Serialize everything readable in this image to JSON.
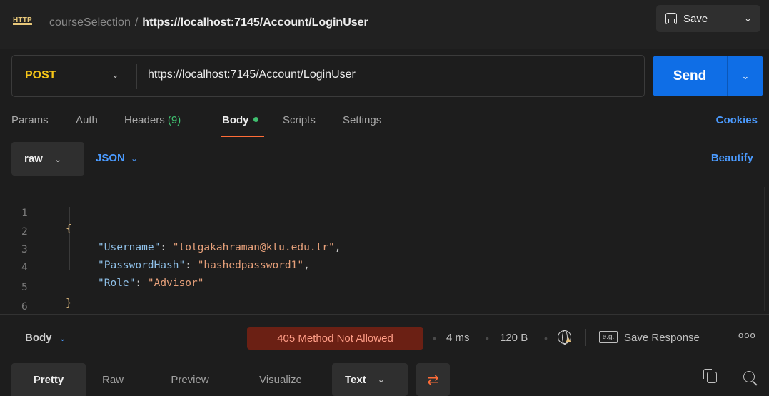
{
  "header": {
    "http_icon": "HTTP",
    "collection": "courseSelection",
    "separator": "/",
    "request_name": "https://localhost:7145/Account/LoginUser",
    "save_label": "Save"
  },
  "request": {
    "method": "POST",
    "url": "https://localhost:7145/Account/LoginUser",
    "send_label": "Send"
  },
  "tabs": {
    "params": "Params",
    "auth": "Auth",
    "headers": "Headers",
    "headers_count": "(9)",
    "body": "Body",
    "scripts": "Scripts",
    "settings": "Settings",
    "cookies": "Cookies"
  },
  "body_toolbar": {
    "mode": "raw",
    "language": "JSON",
    "beautify": "Beautify"
  },
  "editor": {
    "line_numbers": [
      "1",
      "2",
      "3",
      "4",
      "5",
      "6"
    ],
    "open_brace": "{",
    "close_brace": "}",
    "fields": [
      {
        "key": "\"Username\"",
        "value": "\"tolgakahraman@ktu.edu.tr\"",
        "trail": ","
      },
      {
        "key": "\"PasswordHash\"",
        "value": "\"hashedpassword1\"",
        "trail": ","
      },
      {
        "key": "\"Role\"",
        "value": "\"Advisor\"",
        "trail": ""
      }
    ]
  },
  "response": {
    "section_label": "Body",
    "status": "405 Method Not Allowed",
    "time": "4 ms",
    "size": "120 B",
    "eg_icon": "e.g.",
    "save_response": "Save Response",
    "tabs": [
      "Pretty",
      "Raw",
      "Preview",
      "Visualize"
    ],
    "format": "Text"
  },
  "colors": {
    "accent_orange": "#ff6c37",
    "send_blue": "#0f6ee6",
    "link_blue": "#4b9bff",
    "method_yellow": "#f5c518",
    "status_bg": "#6b2014",
    "status_text": "#ff9c86"
  }
}
